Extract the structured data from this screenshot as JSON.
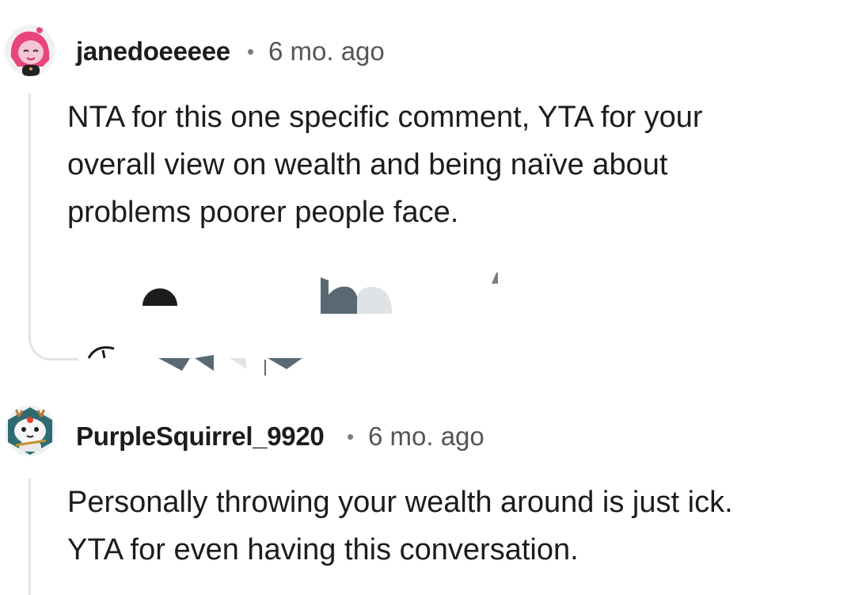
{
  "comments": [
    {
      "username": "janedoeeeee",
      "separator": "•",
      "timestamp": "6 mo. ago",
      "avatar_icon": "pink-hair-snoo-avatar-icon",
      "lines": [
        "NTA for this one specific comment, YTA for your",
        "overall view on wealth and being naïve about",
        "problems poorer people face."
      ]
    },
    {
      "username": "PurpleSquirrel_9920",
      "separator": "•",
      "timestamp": "6 mo. ago",
      "avatar_icon": "antlered-cat-snoo-avatar-icon",
      "lines": [
        "Personally throwing your wealth around is just ick.",
        "YTA for even having this conversation."
      ]
    }
  ],
  "action_icons": [
    "reply-icon",
    "award-icon",
    "share-icon",
    "upvote-icon",
    "vote-count-icon",
    "downvote-icon"
  ],
  "colors": {
    "text": "#1c1c1c",
    "meta": "#555555",
    "thread_line": "#e3e3e3",
    "avatar_pink": "#e8457a",
    "avatar_teal": "#2f6b73"
  }
}
